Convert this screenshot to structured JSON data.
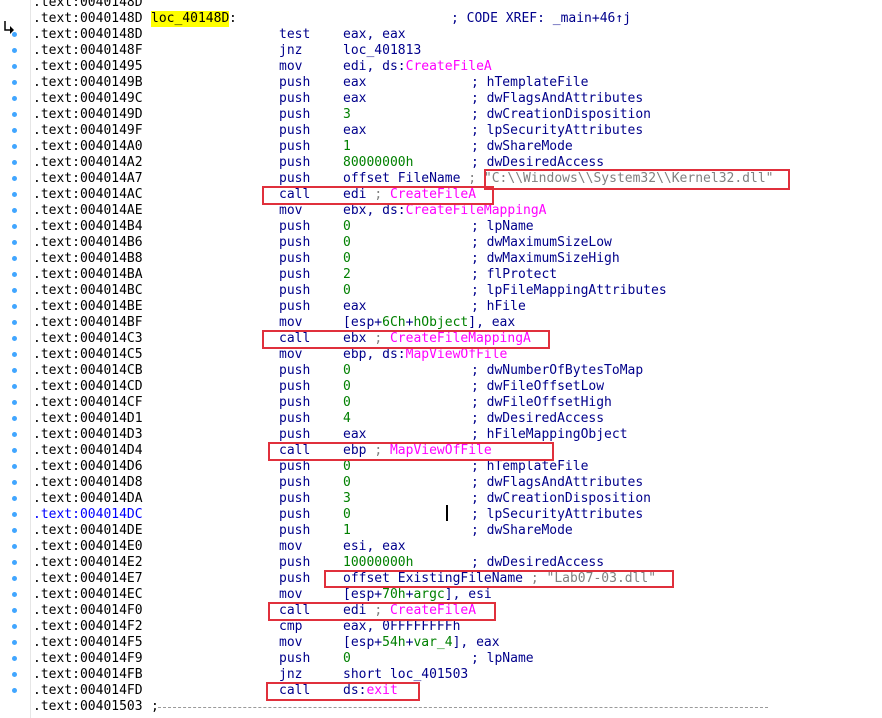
{
  "listing": {
    "rows": [
      {
        "addr": ".text:0040148D",
        "kind": "top"
      },
      {
        "addr": ".text:0040148D",
        "label": "loc_40148D",
        "colon": ":",
        "comment": "; CODE XREF: _main+46↑j"
      },
      {
        "addr": ".text:0040148D",
        "mn": "test",
        "op": "eax, eax"
      },
      {
        "addr": ".text:0040148F",
        "mn": "jnz",
        "op": "loc_401813"
      },
      {
        "addr": ".text:00401495",
        "mn": "mov",
        "op": "edi, ds:",
        "op_api": "CreateFileA"
      },
      {
        "addr": ".text:0040149B",
        "mn": "push",
        "op": "eax",
        "comment": "; hTemplateFile"
      },
      {
        "addr": ".text:0040149C",
        "mn": "push",
        "op": "eax",
        "comment": "; dwFlagsAndAttributes"
      },
      {
        "addr": ".text:0040149D",
        "mn": "push",
        "op_num": "3",
        "comment": "; dwCreationDisposition"
      },
      {
        "addr": ".text:0040149F",
        "mn": "push",
        "op": "eax",
        "comment": "; lpSecurityAttributes"
      },
      {
        "addr": ".text:004014A0",
        "mn": "push",
        "op_num": "1",
        "comment": "; dwShareMode"
      },
      {
        "addr": ".text:004014A2",
        "mn": "push",
        "op_num": "80000000h",
        "comment": "; dwDesiredAccess"
      },
      {
        "addr": ".text:004014A7",
        "mn": "push",
        "op": "offset FileName",
        "semicolon": ";",
        "string": "\"C:\\\\Windows\\\\System32\\\\Kernel32.dll\""
      },
      {
        "addr": ".text:004014AC",
        "mn": "call",
        "op": "edi",
        "inline_comment": ";",
        "inline_api": "CreateFileA"
      },
      {
        "addr": ".text:004014AE",
        "mn": "mov",
        "op": "ebx, ds:",
        "op_api": "CreateFileMappingA"
      },
      {
        "addr": ".text:004014B4",
        "mn": "push",
        "op_num": "0",
        "comment": "; lpName"
      },
      {
        "addr": ".text:004014B6",
        "mn": "push",
        "op_num": "0",
        "comment": "; dwMaximumSizeLow"
      },
      {
        "addr": ".text:004014B8",
        "mn": "push",
        "op_num": "0",
        "comment": "; dwMaximumSizeHigh"
      },
      {
        "addr": ".text:004014BA",
        "mn": "push",
        "op_num": "2",
        "comment": "; flProtect"
      },
      {
        "addr": ".text:004014BC",
        "mn": "push",
        "op_num": "0",
        "comment": "; lpFileMappingAttributes"
      },
      {
        "addr": ".text:004014BE",
        "mn": "push",
        "op": "eax",
        "comment": "; hFile"
      },
      {
        "addr": ".text:004014BF",
        "mn": "mov",
        "op_pre": "[esp+",
        "op_num": "6Ch",
        "op_mid": "+",
        "op_num2": "hObject",
        "op_post": "], eax"
      },
      {
        "addr": ".text:004014C3",
        "mn": "call",
        "op": "ebx",
        "inline_comment": ";",
        "inline_api": "CreateFileMappingA"
      },
      {
        "addr": ".text:004014C5",
        "mn": "mov",
        "op": "ebp, ds:",
        "op_api": "MapViewOfFile"
      },
      {
        "addr": ".text:004014CB",
        "mn": "push",
        "op_num": "0",
        "comment": "; dwNumberOfBytesToMap"
      },
      {
        "addr": ".text:004014CD",
        "mn": "push",
        "op_num": "0",
        "comment": "; dwFileOffsetLow"
      },
      {
        "addr": ".text:004014CF",
        "mn": "push",
        "op_num": "0",
        "comment": "; dwFileOffsetHigh"
      },
      {
        "addr": ".text:004014D1",
        "mn": "push",
        "op_num": "4",
        "comment": "; dwDesiredAccess"
      },
      {
        "addr": ".text:004014D3",
        "mn": "push",
        "op": "eax",
        "comment": "; hFileMappingObject"
      },
      {
        "addr": ".text:004014D4",
        "mn": "call",
        "op": "ebp",
        "inline_comment": ";",
        "inline_api": "MapViewOfFile"
      },
      {
        "addr": ".text:004014D6",
        "mn": "push",
        "op_num": "0",
        "comment": "; hTemplateFile"
      },
      {
        "addr": ".text:004014D8",
        "mn": "push",
        "op_num": "0",
        "comment": "; dwFlagsAndAttributes"
      },
      {
        "addr": ".text:004014DA",
        "mn": "push",
        "op_num": "3",
        "comment": "; dwCreationDisposition"
      },
      {
        "addr": ".text:004014DC",
        "mn": "push",
        "op_num": "0",
        "comment": "; lpSecurityAttributes",
        "blue": true
      },
      {
        "addr": ".text:004014DE",
        "mn": "push",
        "op_num": "1",
        "comment": "; dwShareMode"
      },
      {
        "addr": ".text:004014E0",
        "mn": "mov",
        "op": "esi, eax"
      },
      {
        "addr": ".text:004014E2",
        "mn": "push",
        "op_num": "10000000h",
        "comment": "; dwDesiredAccess"
      },
      {
        "addr": ".text:004014E7",
        "mn": "push",
        "op": "offset ExistingFileName",
        "semicolon": ";",
        "string": "\"Lab07-03.dll\""
      },
      {
        "addr": ".text:004014EC",
        "mn": "mov",
        "op_pre": "[esp+",
        "op_num": "70h",
        "op_mid": "+",
        "op_num2": "argc",
        "op_post": "], esi"
      },
      {
        "addr": ".text:004014F0",
        "mn": "call",
        "op": "edi",
        "inline_comment": ";",
        "inline_api": "CreateFileA"
      },
      {
        "addr": ".text:004014F2",
        "mn": "cmp",
        "op": "eax, 0FFFFFFFFh"
      },
      {
        "addr": ".text:004014F5",
        "mn": "mov",
        "op_pre": "[esp+",
        "op_num": "54h",
        "op_mid": "+",
        "op_num2": "var_4",
        "op_post": "], eax"
      },
      {
        "addr": ".text:004014F9",
        "mn": "push",
        "op_num": "0",
        "comment": "; lpName"
      },
      {
        "addr": ".text:004014FB",
        "mn": "jnz",
        "op": "short loc_401503"
      },
      {
        "addr": ".text:004014FD",
        "mn": "call",
        "op": "ds:",
        "op_api": "exit"
      },
      {
        "addr": ".text:00401503",
        "tail": ";"
      }
    ]
  },
  "colors": {
    "highlight_box": "#e0303c",
    "api_name": "#ff00ff",
    "number": "#008000",
    "label_bg": "#ffff00",
    "code": "#00008b",
    "string": "#808080"
  },
  "icons": {
    "flow_arrow": "arrow-icon",
    "breakpoint_dot": "breakpoint-dot-icon"
  }
}
